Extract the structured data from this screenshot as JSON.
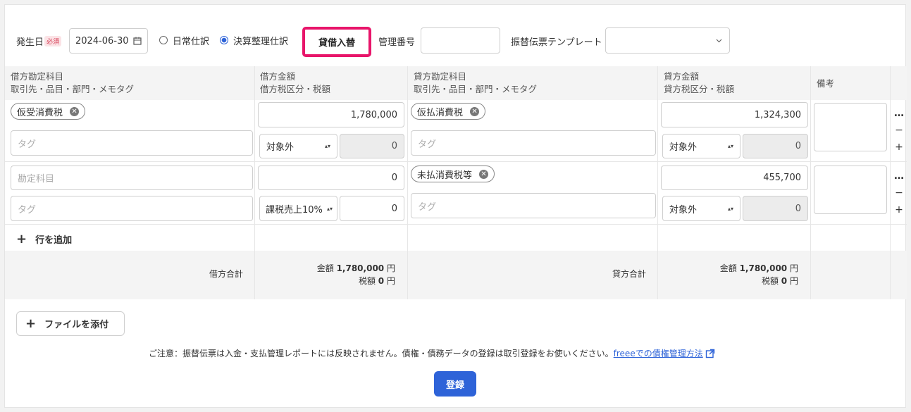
{
  "toolbar": {
    "date_label": "発生日",
    "required_badge": "必須",
    "date_value": "2024-06-30",
    "radio_normal": "日常仕訳",
    "radio_closing": "決算整理仕訳",
    "swap_button": "貸借入替",
    "control_number_label": "管理番号",
    "control_number_value": "",
    "template_label": "振替伝票テンプレート",
    "template_value": "",
    "highlight_color": "#e8156a"
  },
  "table": {
    "headers": {
      "debit_account_1": "借方勘定科目",
      "debit_account_2": "取引先・品目・部門・メモタグ",
      "debit_amount_1": "借方金額",
      "debit_amount_2": "借方税区分・税額",
      "credit_account_1": "貸方勘定科目",
      "credit_account_2": "取引先・品目・部門・メモタグ",
      "credit_amount_1": "貸方金額",
      "credit_amount_2": "貸方税区分・税額",
      "note": "備考"
    },
    "rows": [
      {
        "debit_account": "仮受消費税",
        "debit_amount": "1,780,000",
        "debit_tag_placeholder": "タグ",
        "debit_tax": "対象外",
        "debit_tax_amount": "0",
        "credit_account": "仮払消費税",
        "credit_tag_placeholder": "タグ",
        "credit_amount": "1,324,300",
        "credit_tax": "対象外",
        "credit_tax_amount": "0"
      },
      {
        "debit_account_placeholder": "勘定科目",
        "debit_amount": "0",
        "debit_tag_placeholder": "タグ",
        "debit_tax": "課税売上10%",
        "debit_tax_amount": "0",
        "credit_account": "未払消費税等",
        "credit_tag_placeholder": "タグ",
        "credit_amount": "455,700",
        "credit_tax": "対象外",
        "credit_tax_amount": "0"
      }
    ],
    "row_actions": {
      "more": "…",
      "remove": "−",
      "add": "+"
    },
    "add_row": "行を追加",
    "totals": {
      "debit_label": "借方合計",
      "credit_label": "貸方合計",
      "amount_label": "金額",
      "tax_label": "税額",
      "debit_amount": "1,780,000",
      "debit_tax": "0",
      "credit_amount": "1,780,000",
      "credit_tax": "0",
      "unit": "円"
    }
  },
  "attach_button": "ファイルを添付",
  "notice": "ご注意：振替伝票は入金・支払管理レポートには反映されません。債権・債務データの登録は取引登録をお使いください。",
  "notice_link": "freeeでの債権管理方法",
  "submit_button": "登録"
}
